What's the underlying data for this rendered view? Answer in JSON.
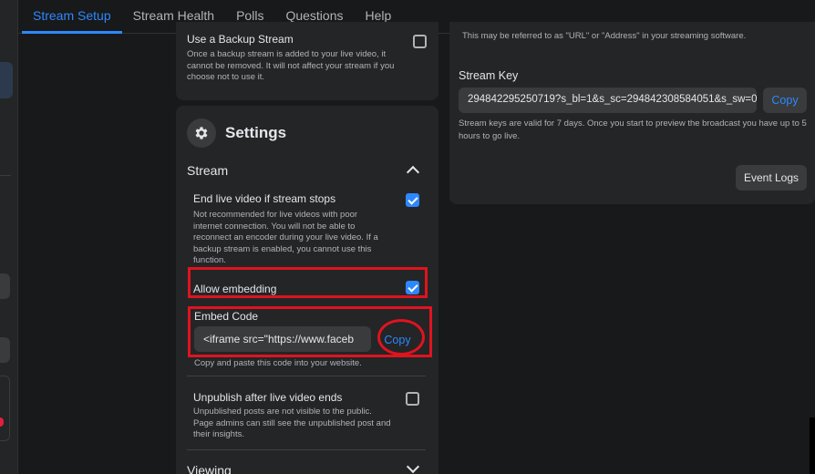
{
  "nav": {
    "tabs": [
      {
        "label": "Stream Setup",
        "active": true
      },
      {
        "label": "Stream Health",
        "active": false
      },
      {
        "label": "Polls",
        "active": false
      },
      {
        "label": "Questions",
        "active": false
      },
      {
        "label": "Help",
        "active": false
      }
    ]
  },
  "backup": {
    "title": "Use a Backup Stream",
    "description": "Once a backup stream is added to your live video, it cannot be removed. It will not affect your stream if you choose not to use it.",
    "checked": false
  },
  "settings": {
    "icon": "gear-icon",
    "title": "Settings",
    "stream_section": "Stream",
    "end_live": {
      "title": "End live video if stream stops",
      "description": "Not recommended for live videos with poor internet connection. You will not be able to reconnect an encoder during your live video. If a backup stream is enabled, you cannot use this function.",
      "checked": true
    },
    "allow_embedding": {
      "title": "Allow embedding",
      "checked": true
    },
    "embed": {
      "label": "Embed Code",
      "value": "<iframe src=\"https://www.faceb",
      "copy_label": "Copy",
      "hint": "Copy and paste this code into your website."
    },
    "unpublish": {
      "title": "Unpublish after live video ends",
      "description": "Unpublished posts are not visible to the public. Page admins can still see the unpublished post and their insights.",
      "checked": false
    },
    "viewing_section": "Viewing"
  },
  "right": {
    "url_note": "This may be referred to as \"URL\" or \"Address\" in your streaming software.",
    "stream_key_label": "Stream Key",
    "stream_key_value": "294842295250719?s_bl=1&s_sc=294842308584051&s_sw=0",
    "copy_label": "Copy",
    "stream_key_desc": "Stream keys are valid for 7 days. Once you start to preview the broadcast you have up to 5 hours to go live.",
    "event_logs_label": "Event Logs"
  },
  "colors": {
    "accent": "#2d88ff",
    "highlight": "#e0131f",
    "background": "#18191a",
    "card": "#242526"
  }
}
